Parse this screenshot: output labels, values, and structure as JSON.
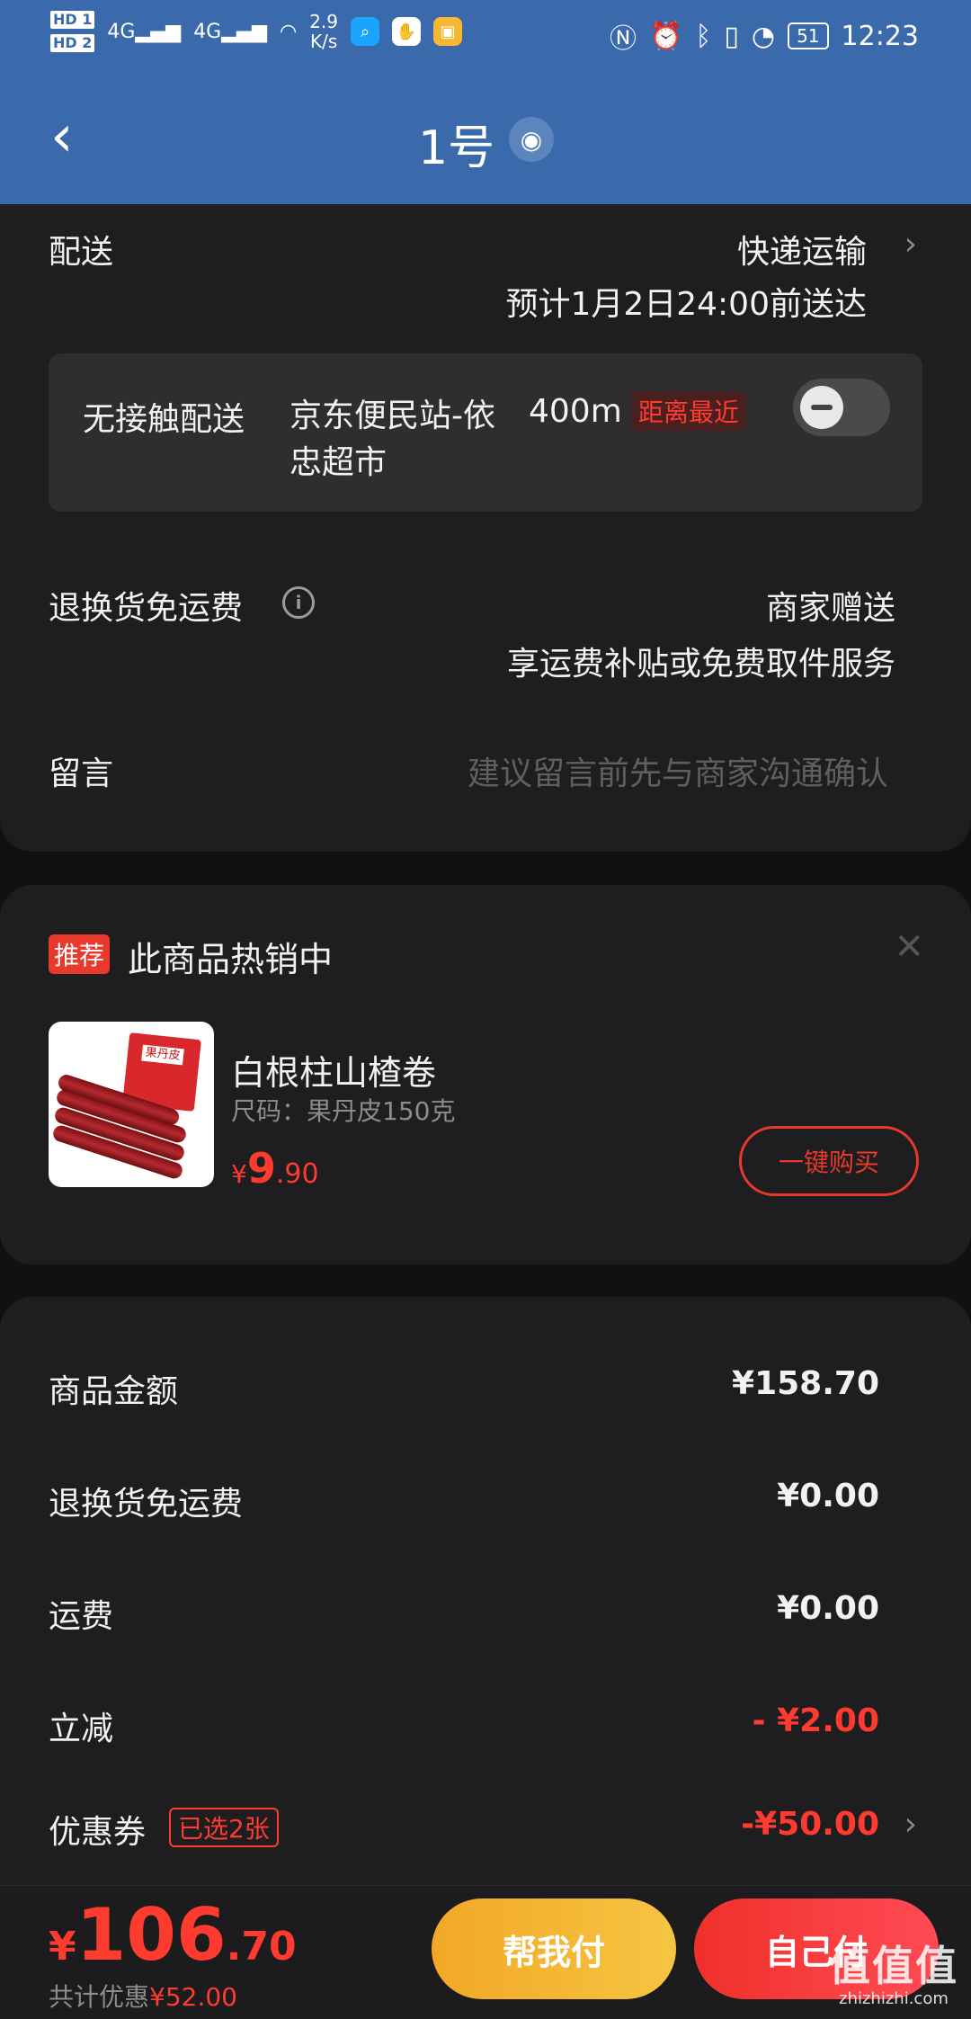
{
  "status_bar": {
    "hd1": "HD 1",
    "hd2": "HD 2",
    "net1": "4G",
    "net2": "4G",
    "speed_value": "2.9",
    "speed_unit": "K/s",
    "battery": "51",
    "time": "12:23"
  },
  "header": {
    "title": "1号"
  },
  "delivery": {
    "label": "配送",
    "method": "快递运输",
    "eta": "预计1月2日24:00前送达"
  },
  "no_contact": {
    "label": "无接触配送",
    "station": "京东便民站-依忠超市",
    "distance": "400m",
    "tag": "距离最近"
  },
  "return_shipping": {
    "label": "退换货免运费",
    "value": "商家赠送",
    "desc": "享运费补贴或免费取件服务"
  },
  "message": {
    "label": "留言",
    "placeholder": "建议留言前先与商家沟通确认"
  },
  "recommend": {
    "tag": "推荐",
    "title": "此商品热销中",
    "product": {
      "thumb_text": "果丹皮",
      "name": "白根柱山楂卷",
      "spec": "尺码：果丹皮150克",
      "currency": "¥",
      "price_int": "9",
      "price_dec": ".90",
      "buy_label": "一键购买"
    }
  },
  "summary": {
    "rows": [
      {
        "label": "商品金额",
        "value": "¥158.70"
      },
      {
        "label": "退换货免运费",
        "value": "¥0.00"
      },
      {
        "label": "运费",
        "value": "¥0.00"
      },
      {
        "label": "立减",
        "value": "- ¥2.00"
      },
      {
        "label": "优惠券",
        "tag": "已选2张",
        "value": "-¥50.00"
      }
    ]
  },
  "bottom": {
    "currency": "¥",
    "total_int": "106",
    "total_dec": ".70",
    "saved_label": "共计优惠",
    "saved_value": "¥52.00",
    "help_pay": "帮我付",
    "self_pay": "自己付"
  },
  "watermark": {
    "line1": "值值值",
    "line2": "zhizhizhi.com"
  },
  "colors": {
    "header_bg": "#3a6aac",
    "accent_red": "#ff3b30",
    "bg": "#111111",
    "card_bg": "#1e1e20"
  }
}
